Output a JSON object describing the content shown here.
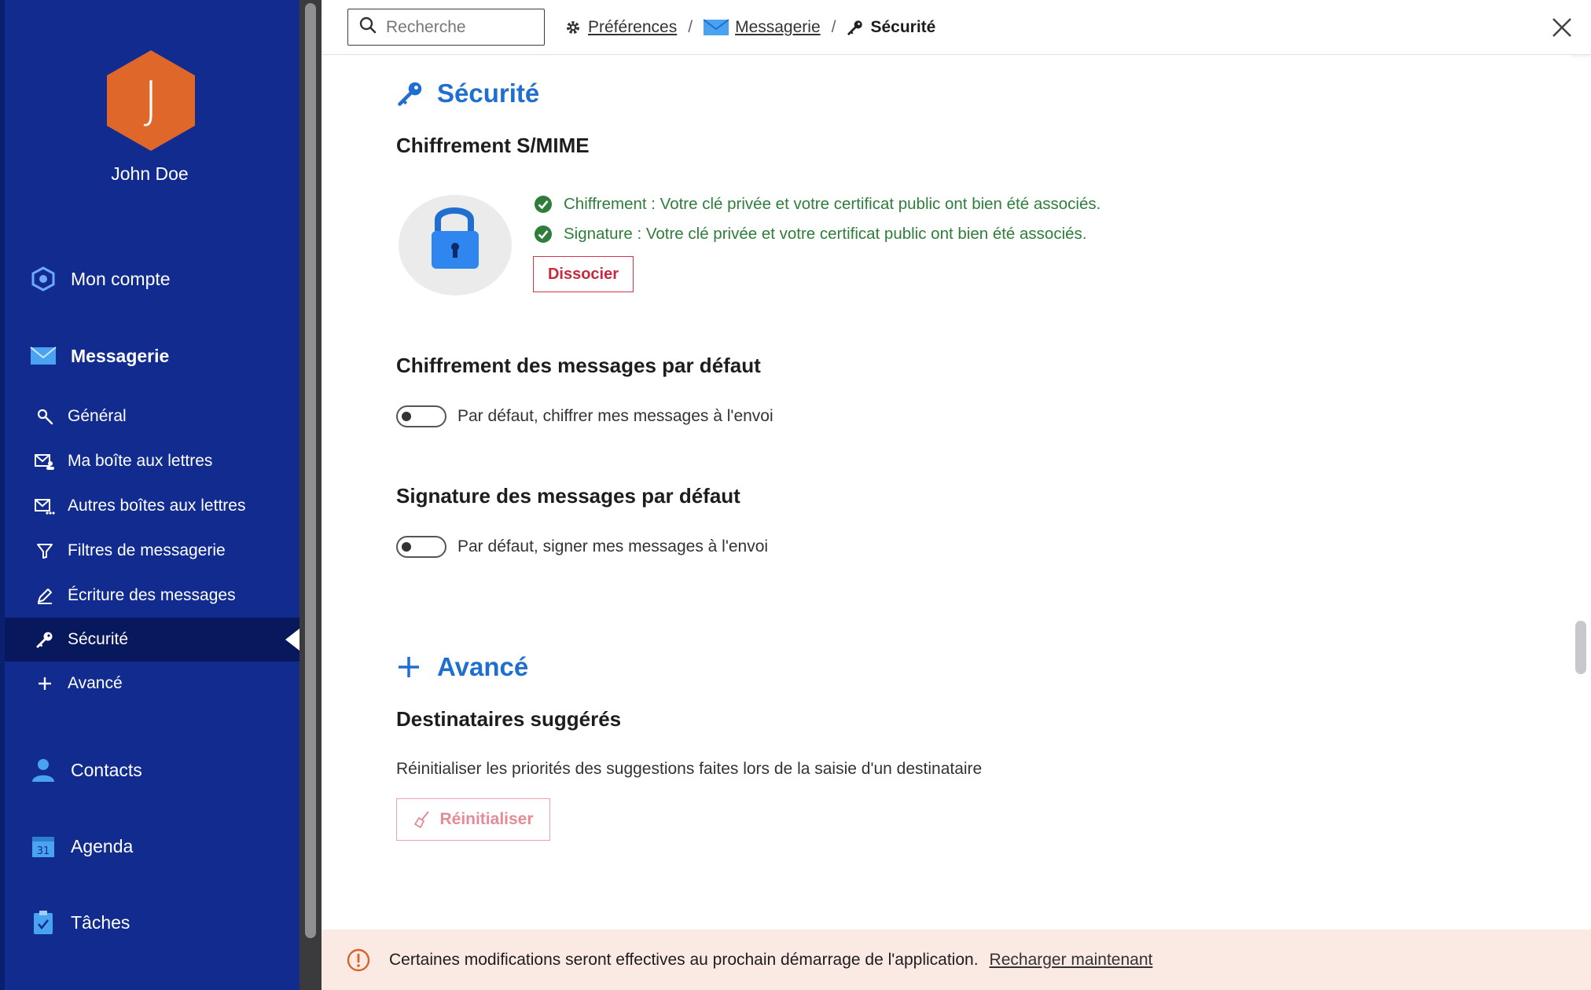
{
  "user": {
    "initial": "J",
    "name": "John Doe",
    "avatar_color": "#e0672a"
  },
  "sidebar": {
    "background": "#112b8e",
    "main_items": [
      {
        "label": "Mon compte",
        "icon": "account-hexagon-icon"
      },
      {
        "label": "Messagerie",
        "icon": "envelope-icon"
      },
      {
        "label": "Contacts",
        "icon": "person-icon"
      },
      {
        "label": "Agenda",
        "icon": "calendar-icon"
      },
      {
        "label": "Tâches",
        "icon": "clipboard-check-icon"
      }
    ],
    "sub_items": [
      {
        "label": "Général",
        "icon": "wrench-icon"
      },
      {
        "label": "Ma boîte aux lettres",
        "icon": "mailbox-user-icon"
      },
      {
        "label": "Autres boîtes aux lettres",
        "icon": "mailbox-multiple-icon"
      },
      {
        "label": "Filtres de messagerie",
        "icon": "filter-icon"
      },
      {
        "label": "Écriture des messages",
        "icon": "pen-icon"
      },
      {
        "label": "Sécurité",
        "icon": "key-icon",
        "active": true
      },
      {
        "label": "Avancé",
        "icon": "plus-icon"
      }
    ],
    "calendar_day": "31"
  },
  "header": {
    "search_placeholder": "Recherche",
    "breadcrumb": {
      "preferences": "Préférences",
      "separator": "/",
      "messagerie": "Messagerie",
      "current": "Sécurité"
    }
  },
  "security": {
    "title": "Sécurité",
    "smime": {
      "heading": "Chiffrement S/MIME",
      "status_encryption": "Chiffrement : Votre clé privée et votre certificat public ont bien été associés.",
      "status_signature": "Signature : Votre clé privée et votre certificat public ont bien été associés.",
      "dissociate_label": "Dissocier"
    },
    "default_encryption": {
      "heading": "Chiffrement des messages par défaut",
      "toggle_label": "Par défaut, chiffrer mes messages à l'envoi",
      "enabled": false
    },
    "default_signature": {
      "heading": "Signature des messages par défaut",
      "toggle_label": "Par défaut, signer mes messages à l'envoi",
      "enabled": false
    }
  },
  "advanced": {
    "title": "Avancé",
    "suggested": {
      "heading": "Destinataires suggérés",
      "description": "Réinitialiser les priorités des suggestions faites lors de la saisie d'un destinataire",
      "reset_label": "Réinitialiser"
    }
  },
  "notice": {
    "message": "Certaines modifications seront effectives au prochain démarrage de l'application.",
    "action": "Recharger maintenant"
  },
  "colors": {
    "accent": "#1f6fd1",
    "success": "#2f7d3a",
    "danger": "#c8293d",
    "notice_bg": "#fbe9e3"
  }
}
